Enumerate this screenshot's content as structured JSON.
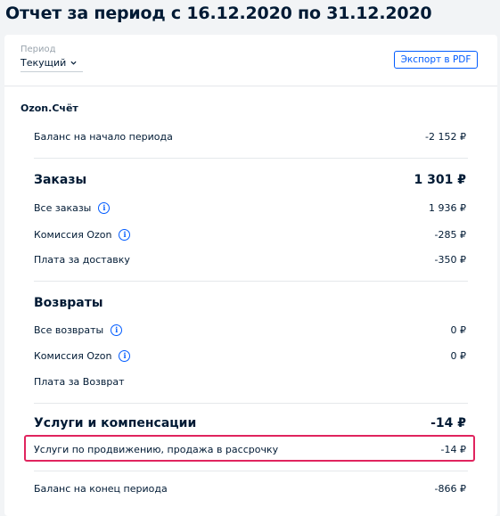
{
  "title": "Отчет за период с 16.12.2020 по 31.12.2020",
  "period": {
    "label": "Период",
    "value": "Текущий"
  },
  "export_button": "Экспорт в PDF",
  "section": "Ozon.Счёт",
  "opening_balance": {
    "label": "Баланс на начало периода",
    "value": "-2 152 ₽"
  },
  "orders": {
    "title": "Заказы",
    "total": "1 301 ₽",
    "rows": [
      {
        "label": "Все заказы",
        "value": "1 936 ₽"
      },
      {
        "label": "Комиссия Ozon",
        "value": "-285 ₽"
      },
      {
        "label": "Плата за доставку",
        "value": "-350 ₽"
      }
    ]
  },
  "returns": {
    "title": "Возвраты",
    "rows": [
      {
        "label": "Все возвраты",
        "value": "0 ₽"
      },
      {
        "label": "Комиссия Ozon",
        "value": "0 ₽"
      },
      {
        "label": "Плата за Возврат",
        "value": ""
      }
    ]
  },
  "services": {
    "title": "Услуги и компенсации",
    "total": "-14 ₽",
    "rows": [
      {
        "label": "Услуги по продвижению, продажа в рассрочку",
        "value": "-14 ₽"
      }
    ]
  },
  "closing_balance": {
    "label": "Баланс на конец периода",
    "value": "-866 ₽"
  },
  "icons": {
    "info": "info-icon",
    "chevron": "chevron-down-icon"
  },
  "colors": {
    "accent": "#005bff",
    "highlight": "#e0245e",
    "text": "#001a34",
    "background": "#f2f4f6"
  }
}
